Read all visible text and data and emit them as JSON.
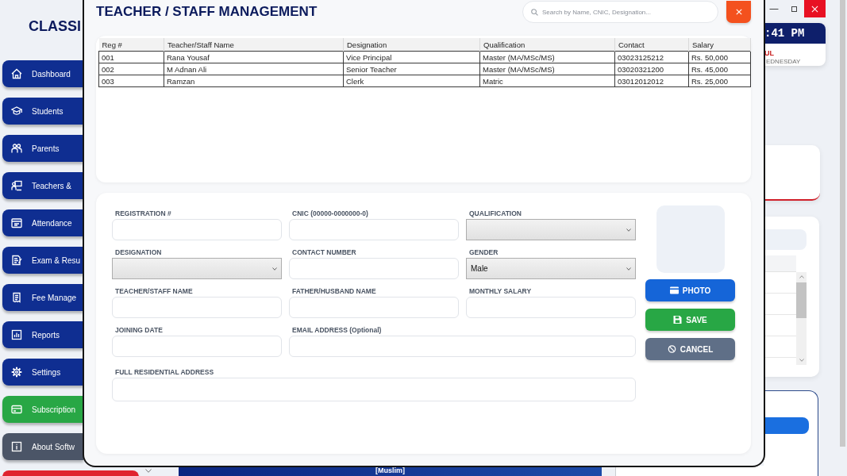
{
  "sidebar": {
    "title": "CLASSI",
    "items": [
      {
        "label": "Dashboard",
        "color": "#0f2e91"
      },
      {
        "label": "Students",
        "color": "#0f2e91"
      },
      {
        "label": "Parents",
        "color": "#0f2e91"
      },
      {
        "label": "Teachers &",
        "color": "#0f2e91"
      },
      {
        "label": "Attendance",
        "color": "#0f2e91"
      },
      {
        "label": "Exam & Resu",
        "color": "#0f2e91"
      },
      {
        "label": "Fee Manage",
        "color": "#0f2e91"
      },
      {
        "label": "Reports",
        "color": "#0f2e91"
      },
      {
        "label": "Settings",
        "color": "#0f2e91"
      },
      {
        "label": "Subscription",
        "color": "#28a745"
      },
      {
        "label": "About Softw",
        "color": "#4b5567"
      },
      {
        "color": "#e0232e"
      }
    ]
  },
  "dialog": {
    "title": "TEACHER / STAFF MANAGEMENT",
    "search": {
      "placeholder": "Search by Name, CNIC, Designation..."
    },
    "table": {
      "columns": [
        "Reg #",
        "Teacher/Staff Name",
        "Designation",
        "Qualification",
        "Contact",
        "Salary"
      ],
      "rows": [
        [
          "001",
          "Rana Yousaf",
          "Vice Principal",
          "Master (MA/MSc/MS)",
          "03023125212",
          "Rs. 50,000"
        ],
        [
          "002",
          "M Adnan Ali",
          "Senior Teacher",
          "Master (MA/MSc/MS)",
          "03020321200",
          "Rs. 45,000"
        ],
        [
          "003",
          "Ramzan",
          "Clerk",
          "Matric",
          "03012012012",
          "Rs. 25,000"
        ]
      ]
    },
    "form": {
      "rows": [
        [
          {
            "label": "REGISTRATION #",
            "kind": "text"
          },
          {
            "label": "CNIC (00000-0000000-0)",
            "kind": "text"
          },
          {
            "label": "QUALIFICATION",
            "kind": "select"
          }
        ],
        [
          {
            "label": "DESIGNATION",
            "kind": "select"
          },
          {
            "label": "CONTACT NUMBER",
            "kind": "text"
          },
          {
            "label": "GENDER",
            "kind": "select",
            "value": "Male"
          }
        ],
        [
          {
            "label": "TEACHER/STAFF NAME",
            "kind": "text"
          },
          {
            "label": "FATHER/HUSBAND NAME",
            "kind": "text"
          },
          {
            "label": "MONTHLY SALARY",
            "kind": "text"
          }
        ],
        [
          {
            "label": "JOINING DATE",
            "kind": "text"
          },
          {
            "label": "EMAIL ADDRESS (Optional)",
            "kind": "text"
          }
        ],
        [
          {
            "label": "FULL RESIDENTIAL ADDRESS",
            "kind": "text"
          }
        ]
      ]
    },
    "buttons": [
      {
        "label": "PHOTO",
        "kind": "photo"
      },
      {
        "label": "SAVE",
        "kind": "save"
      },
      {
        "label": "CANCEL",
        "kind": "cancel"
      }
    ]
  },
  "clock": {
    "time": ":41 PM",
    "month": "UL",
    "weekday": "EDNESDAY"
  },
  "banner": {
    "text": "[Muslim]"
  }
}
